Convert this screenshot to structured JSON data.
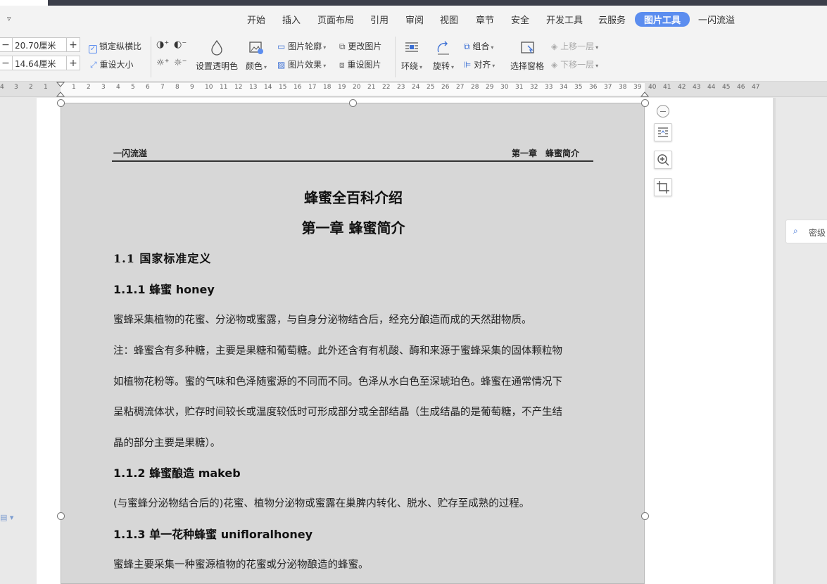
{
  "menu": {
    "items": [
      "开始",
      "插入",
      "页面布局",
      "引用",
      "审阅",
      "视图",
      "章节",
      "安全",
      "开发工具",
      "云服务"
    ],
    "active_tab": "图片工具",
    "user_tab": "一闪流溢"
  },
  "ribbon": {
    "width_value": "20.70厘米",
    "height_value": "14.64厘米",
    "lock_ratio": "锁定纵横比",
    "reset_size": "重设大小",
    "transparency": "设置透明色",
    "color": "颜色",
    "outline": "图片轮廓",
    "effects": "图片效果",
    "change_picture": "更改图片",
    "reset_picture": "重设图片",
    "wrap": "环绕",
    "rotate": "旋转",
    "group": "组合",
    "align": "对齐",
    "selection_pane": "选择窗格",
    "bring_forward": "上移一层",
    "send_backward": "下移一层",
    "plus": "+",
    "minus": "−"
  },
  "ruler": {
    "left_numbers": [
      "4",
      "3",
      "2",
      "1"
    ],
    "numbers": [
      "1",
      "2",
      "3",
      "4",
      "5",
      "6",
      "7",
      "8",
      "9",
      "10",
      "11",
      "12",
      "13",
      "14",
      "15",
      "16",
      "17",
      "18",
      "19",
      "20",
      "21",
      "22",
      "23",
      "24",
      "25",
      "26",
      "27",
      "28",
      "29",
      "30",
      "31",
      "32",
      "33",
      "34",
      "35",
      "36",
      "37",
      "38",
      "39",
      "40",
      "41",
      "42",
      "43",
      "44",
      "45",
      "46",
      "47"
    ]
  },
  "document": {
    "header_left": "一闪流溢",
    "header_right": "第一章　蜂蜜简介",
    "title": "蜂蜜全百科介绍",
    "chapter": "第一章 蜂蜜简介",
    "section_1_1": "1.1 国家标准定义",
    "h_1_1_1": "1.1.1 蜂蜜 honey",
    "p1": "蜜蜂采集植物的花蜜、分泌物或蜜露，与自身分泌物结合后，经充分酿造而成的天然甜物质。",
    "p2_l1": "注：蜂蜜含有多种糖，主要是果糖和葡萄糖。此外还含有有机酸、酶和来源于蜜蜂采集的固体颗粒物",
    "p2_l2": "如植物花粉等。蜜的气味和色泽随蜜源的不同而不同。色泽从水白色至深琥珀色。蜂蜜在通常情况下",
    "p2_l3": "呈粘稠流体状，贮存时间较长或温度较低时可形成部分或全部结晶（生成结晶的是葡萄糖，不产生结",
    "p2_l4": "晶的部分主要是果糖）。",
    "h_1_1_2": "1.1.2 蜂蜜酿造 makeb",
    "p3": "(与蜜蜂分泌物结合后的)花蜜、植物分泌物或蜜露在巢脾内转化、脱水、贮存至成熟的过程。",
    "h_1_1_3": "1.1.3 单一花种蜂蜜 unifloralhoney",
    "p4": "蜜蜂主要采集一种蜜源植物的花蜜或分泌物酿造的蜂蜜。"
  },
  "side": {
    "secret_label": "密级"
  },
  "colors": {
    "accent": "#5b8def",
    "image_bg": "#d7d7d7"
  }
}
